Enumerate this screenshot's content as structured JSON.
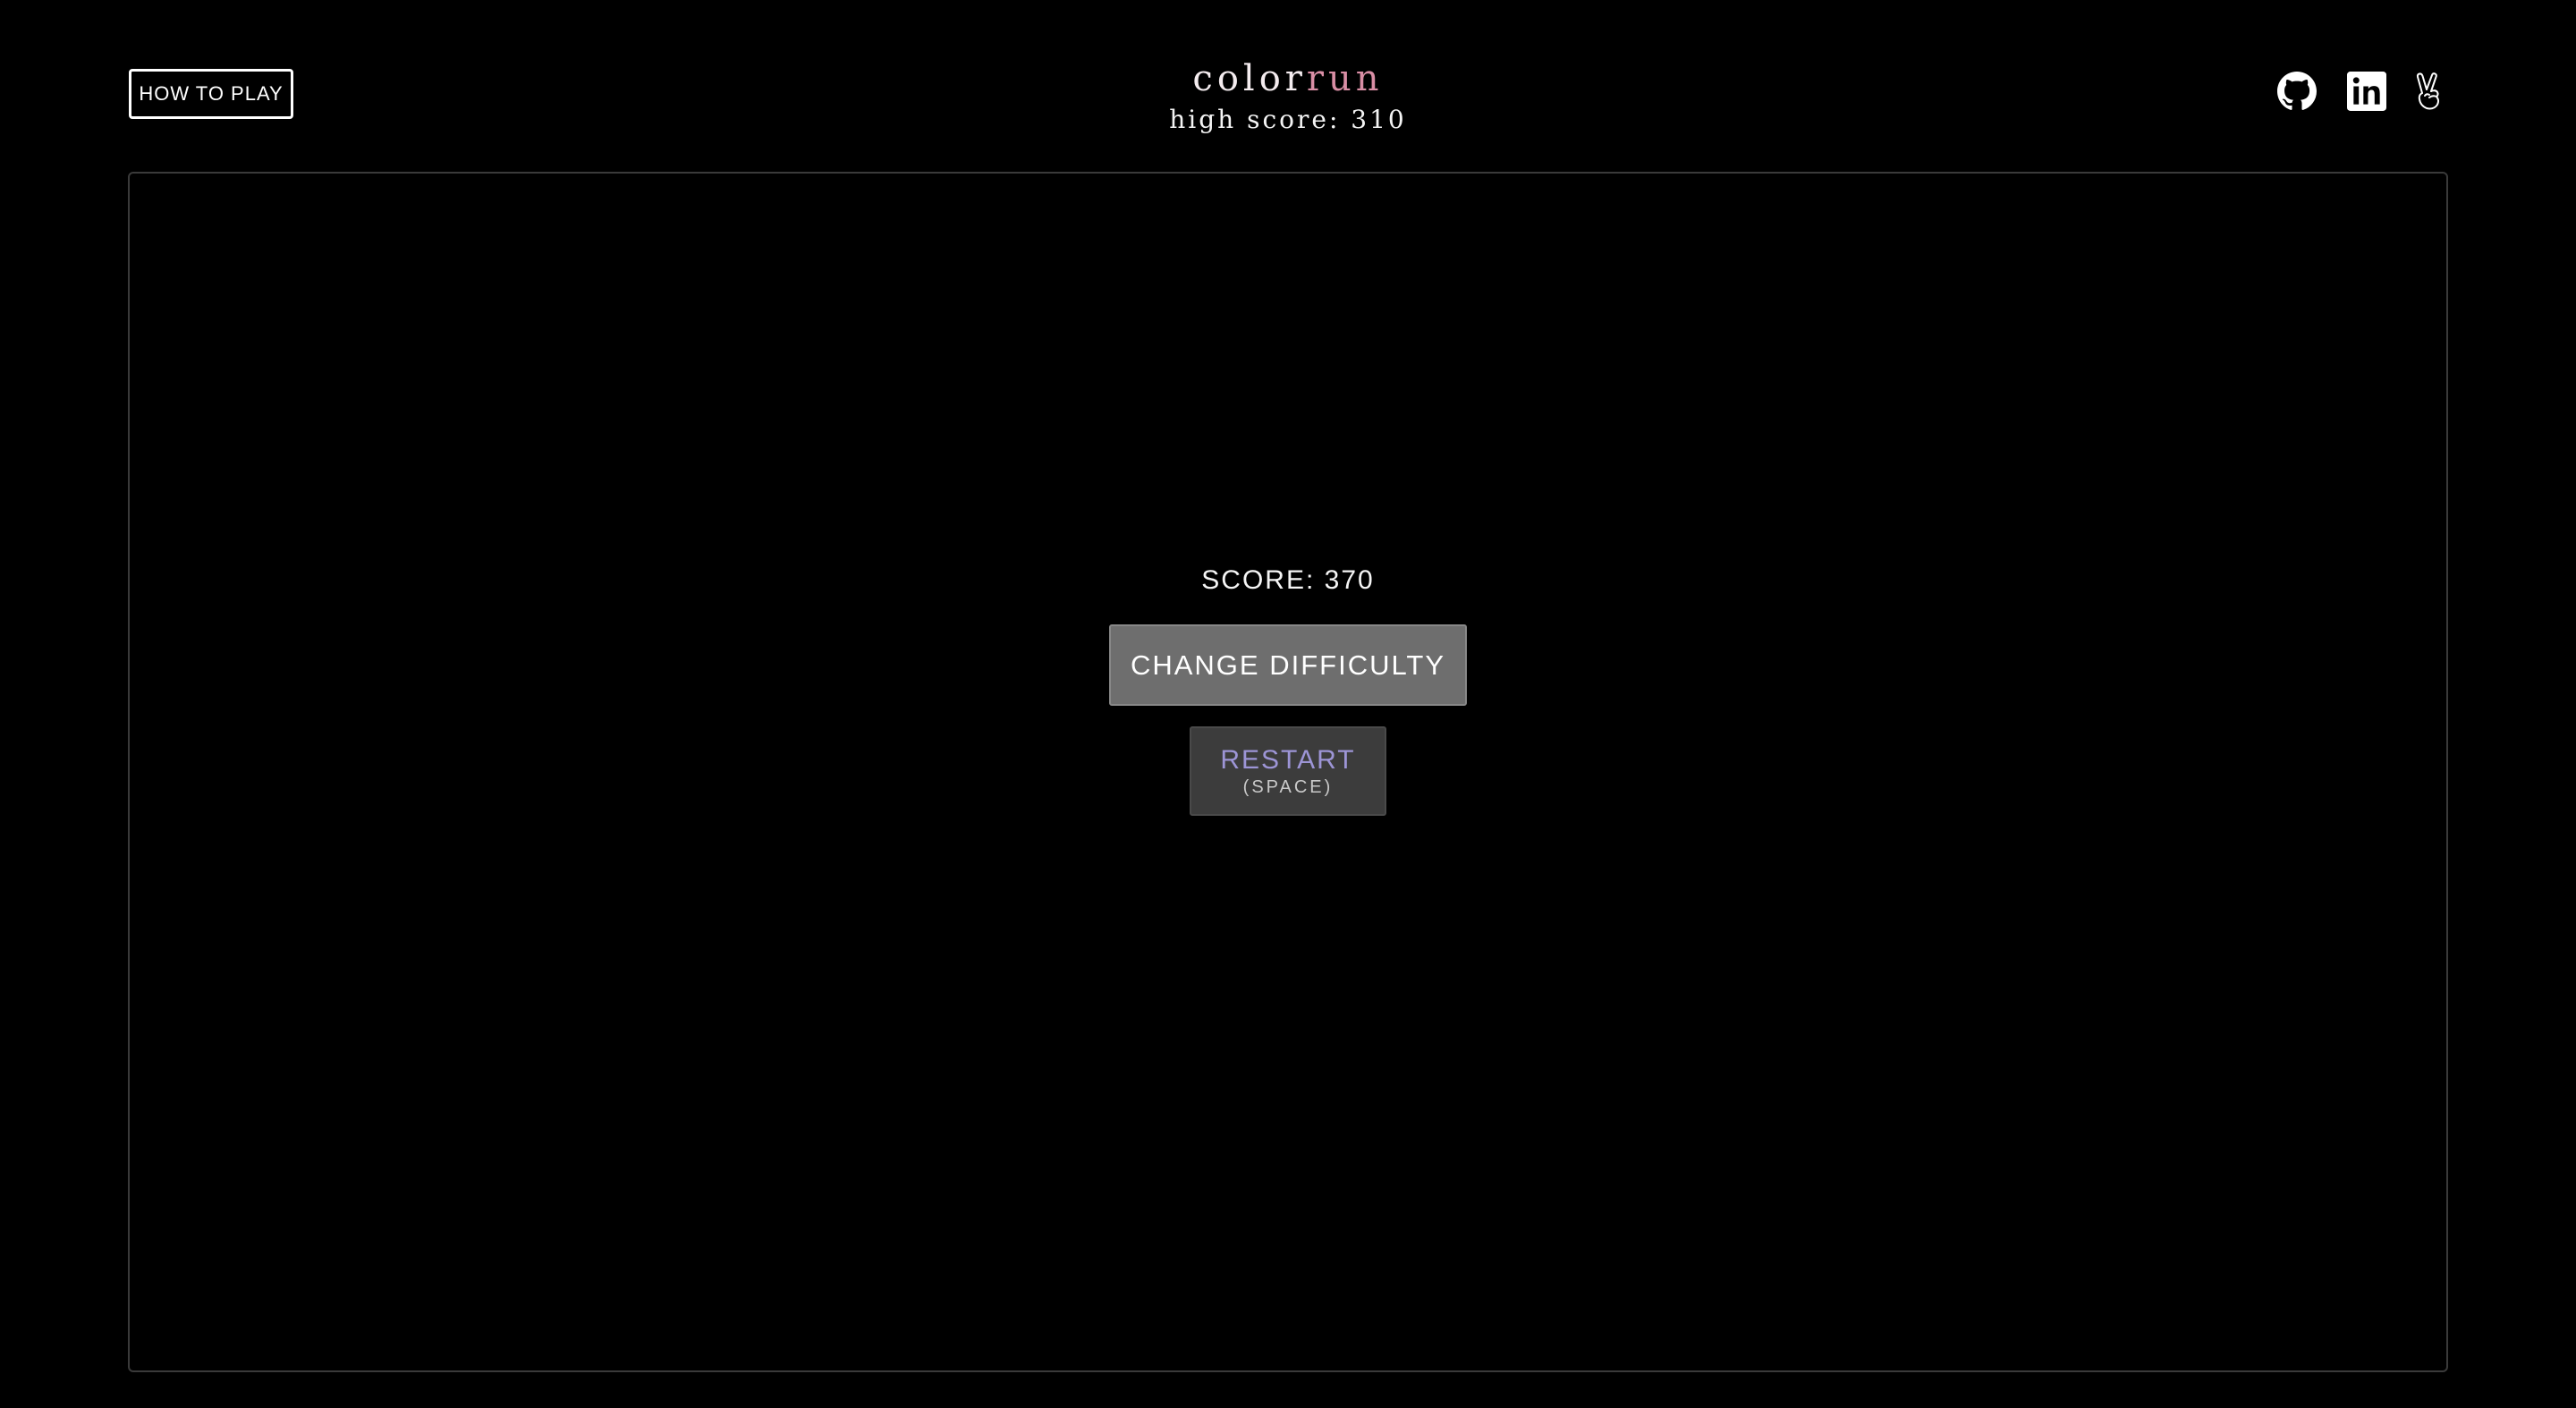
{
  "header": {
    "how_to_play_label": "HOW TO PLAY",
    "title_part1": "color",
    "title_part2": "run",
    "high_score": "high score: 310"
  },
  "socials": [
    {
      "icon": "github-icon"
    },
    {
      "icon": "linkedin-icon"
    },
    {
      "icon": "peace-hand-icon"
    }
  ],
  "game": {
    "score": "SCORE: 370",
    "change_difficulty_label": "CHANGE DIFFICULTY",
    "restart_label": "RESTART",
    "restart_hint": "(SPACE)"
  },
  "colors": {
    "background": "#000000",
    "title_accent": "#d98ea5",
    "restart_text": "#9d95d6",
    "change_button_bg": "#6e6e6e",
    "restart_button_bg": "#3c3c3c"
  }
}
